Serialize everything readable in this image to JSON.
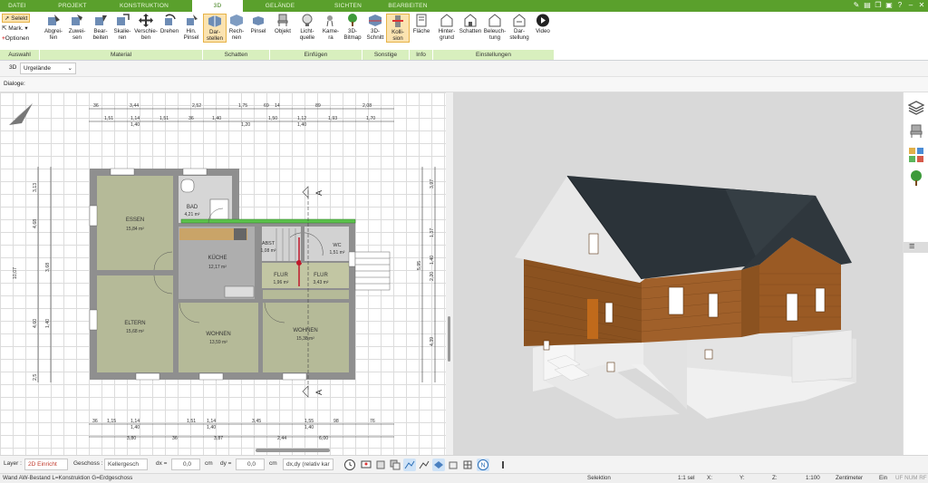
{
  "tabs": [
    "DATEI",
    "PROJEKT",
    "KONSTRUKTION",
    "3D",
    "GELÄNDE",
    "SICHTEN",
    "BEARBEITEN"
  ],
  "active_tab": "3D",
  "ribbon": {
    "auswahl": {
      "select": "Selekt",
      "mark": "Mark.",
      "options": "Optionen"
    },
    "buttons": {
      "abgreifen": "Abgrei-\nfen",
      "zuweisen": "Zuwei-\nsen",
      "bearbeiten": "Bear-\nbeiten",
      "skalieren": "Skalie-\nren",
      "verschieben": "Verschie-\nben",
      "drehen": "Drehen",
      "hin_pinsel": "Hin.\nPinsel",
      "darstellen": "Dar-\nstellen",
      "rechnen": "Rech-\nnen",
      "pinsel": "Pinsel",
      "objekt": "Objekt",
      "lichtquelle": "Licht-\nquelle",
      "kamera": "Kame-\nra",
      "bitmap": "3D-\nBitmap",
      "schnitt": "3D-\nSchnitt",
      "kollision": "Kolli-\nsion",
      "flaeche": "Fläche",
      "hintergrund": "Hinter-\ngrund",
      "schatten": "Schatten",
      "beleuchtung": "Beleuch-\ntung",
      "darstellung": "Dar-\nstellung",
      "video": "Video"
    },
    "groups": [
      "Auswahl",
      "Material",
      "Schatten",
      "Einfügen",
      "Sonstige",
      "Info",
      "Einstellungen"
    ]
  },
  "viewbar": {
    "mode": "3D",
    "terrain": "Urgelände"
  },
  "dialoge_label": "Dialoge:",
  "plan": {
    "rooms": [
      {
        "name": "ESSEN",
        "area": "15,84 m²"
      },
      {
        "name": "BAD",
        "area": "4,21 m²"
      },
      {
        "name": "KÜCHE",
        "area": "12,17 m²"
      },
      {
        "name": "ABST",
        "area": "1,08 m²"
      },
      {
        "name": "WC",
        "area": "1,51 m²"
      },
      {
        "name": "FLUR",
        "area": "1,96 m²"
      },
      {
        "name": "FLUR",
        "area": "3,43 m²"
      },
      {
        "name": "ELTERN",
        "area": "15,68 m²"
      },
      {
        "name": "WOHNEN",
        "area": "13,59 m²"
      },
      {
        "name": "WOHNEN",
        "area": "15,38 m²"
      }
    ],
    "dims_top1": [
      "36",
      "3,44",
      "2,52",
      "1,75",
      "69",
      "14",
      "89",
      "2,08"
    ],
    "dims_top2": [
      "1,51",
      "1,14",
      "1,40",
      "1,51",
      "36",
      "1,40",
      "1,20",
      "1,50",
      "1,12",
      "1,40",
      "1,93",
      "1,70"
    ],
    "dims_bottom1": [
      "36",
      "1,15",
      "1,14",
      "1,40",
      "1,51",
      "1,14",
      "1,40",
      "3,45",
      "1,55",
      "1,40",
      "98",
      "76"
    ],
    "dims_bottom2": [
      "3,80",
      "36",
      "3,87",
      "2,44",
      "6,00"
    ],
    "dims_left": [
      "3,13",
      "4,68",
      "3,68",
      "10,07",
      "4,60",
      "1,40",
      "2,5"
    ],
    "dims_right": [
      "3,97",
      "1,37",
      "1,40",
      "5,95",
      "2,20",
      "4,39"
    ],
    "section_label": "A"
  },
  "toolbar": {
    "layer_label": "Layer :",
    "layer_value": "2D Einricht",
    "geschoss_label": "Geschoss :",
    "geschoss_value": "Kellergesch",
    "dx_label": "dx =",
    "dx_value": "0,0",
    "dy_label": "dy =",
    "dy_value": "0,0",
    "unit": "cm",
    "mode_value": "dx,dy (relativ kar"
  },
  "status": {
    "info": "Wand AW-Bestand L=Konstruktion G=Erdgeschoss",
    "mode": "Selektion",
    "scale_label": "1:1 sel",
    "x_label": "X:",
    "y_label": "Y:",
    "z_label": "Z:",
    "scale": "1:100",
    "unit": "Zentimeter",
    "ein": "Ein",
    "flags": "UF NUM RF"
  },
  "colors": {
    "ribbon_green": "#5aa02c",
    "group_label_bg": "#d8efbe",
    "active_button_bg": "#fbe3b0",
    "room_fill": "#b5ba98",
    "wall_fill": "#8f8f8f",
    "wood_facade": "#9a5a24",
    "roof": "#2b3339",
    "base": "#e9e9e9"
  }
}
